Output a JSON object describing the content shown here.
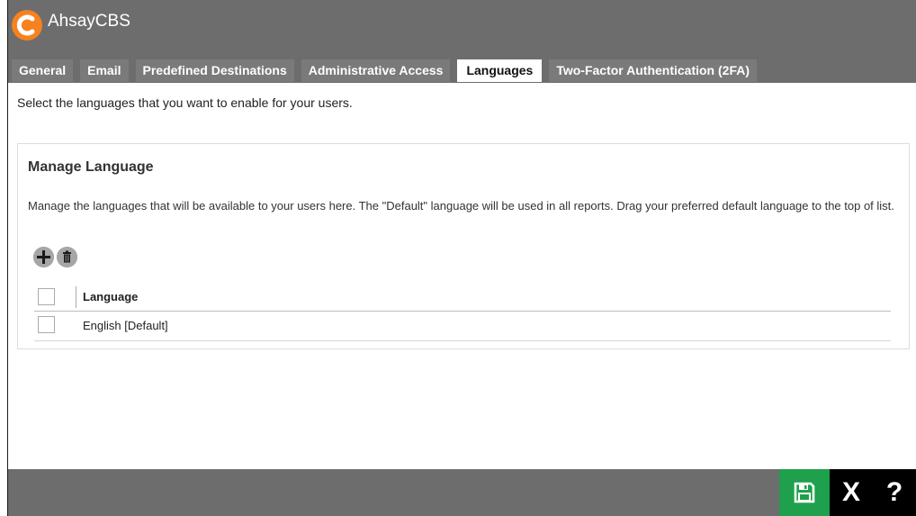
{
  "app": {
    "title": "AhsayCBS"
  },
  "tabs": [
    {
      "label": "General",
      "active": false
    },
    {
      "label": "Email",
      "active": false
    },
    {
      "label": "Predefined Destinations",
      "active": false
    },
    {
      "label": "Administrative Access",
      "active": false
    },
    {
      "label": "Languages",
      "active": true
    },
    {
      "label": "Two-Factor Authentication (2FA)",
      "active": false
    }
  ],
  "intro_text": "Select the languages that you want to enable for your users.",
  "panel": {
    "title": "Manage Language",
    "description": "Manage the languages that will be available to your users here. The \"Default\" language will be used in all reports. Drag your preferred default language to the top of list.",
    "add_icon": "plus-icon",
    "delete_icon": "trash-icon"
  },
  "table": {
    "column_header": "Language",
    "rows": [
      {
        "language": "English [Default]"
      }
    ]
  },
  "footer": {
    "save_icon": "floppy-disk-icon",
    "close_label": "X",
    "help_label": "?"
  },
  "colors": {
    "titlebar": "#6d6d6d",
    "logo": "#f5821f",
    "save": "#1ea04c",
    "tab_inactive": "#7a7a7a"
  }
}
